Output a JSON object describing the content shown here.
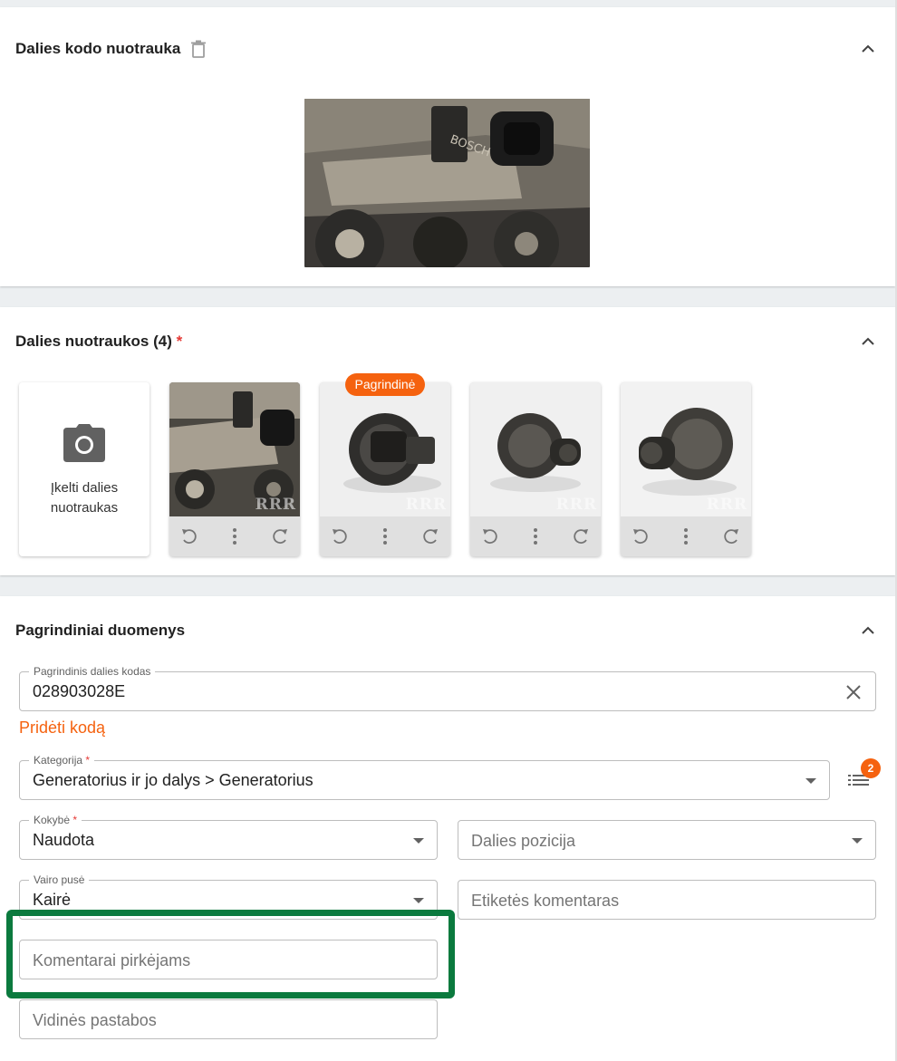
{
  "sections": {
    "code_photo": {
      "title": "Dalies kodo nuotrauka"
    },
    "photos": {
      "title": "Dalies nuotraukos (4)",
      "required_mark": "*",
      "upload_label_line1": "Įkelti dalies",
      "upload_label_line2": "nuotraukas",
      "main_badge": "Pagrindinė",
      "watermark": "RRR"
    },
    "main_data": {
      "title": "Pagrindiniai duomenys",
      "part_code": {
        "label": "Pagrindinis dalies kodas",
        "value": "028903028E"
      },
      "add_code": "Pridėti kodą",
      "category": {
        "label": "Kategorija",
        "required_mark": "*",
        "value": "Generatorius ir jo dalys > Generatorius"
      },
      "category_list_badge": "2",
      "quality": {
        "label": "Kokybė",
        "required_mark": "*",
        "value": "Naudota"
      },
      "position": {
        "placeholder": "Dalies pozicija"
      },
      "steering_side": {
        "label": "Vairo pusė",
        "value": "Kairė"
      },
      "label_comment": {
        "placeholder": "Etiketės komentaras"
      },
      "buyer_comments": {
        "placeholder": "Komentarai pirkėjams"
      },
      "internal_notes": {
        "placeholder": "Vidinės pastabos"
      }
    }
  },
  "colors": {
    "accent": "#f5620f",
    "highlight": "#0b7a3e"
  }
}
